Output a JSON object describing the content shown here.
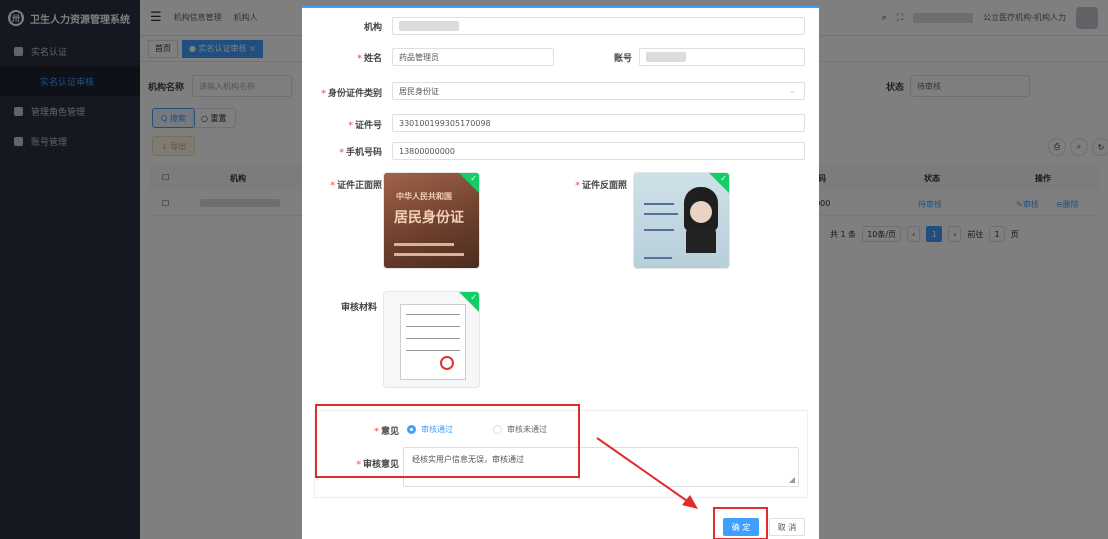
{
  "app": {
    "title": "卫生人力资源管理系统",
    "logo_mark": "(卅)",
    "sidebar": {
      "items": [
        {
          "label": "实名认证"
        },
        {
          "label": "实名认证审核"
        },
        {
          "label": "管理角色管理"
        },
        {
          "label": "账号管理"
        }
      ]
    },
    "topbar": {
      "nav1": "机构信息管理",
      "nav2": "机构人",
      "user_label": "公立医疗机构-机构人力"
    },
    "tabs": [
      {
        "label": "首页"
      },
      {
        "label": "● 实名认证审核 ×"
      }
    ],
    "filter": {
      "org_label": "机构名称",
      "org_placeholder": "请输入机构名称",
      "status_label": "状态",
      "status_value": "待审核",
      "search_btn": "Q 搜索",
      "reset_btn": "○ 重置",
      "export_btn": "↓ 导出"
    },
    "table": {
      "headers": [
        "机构",
        "号码",
        "状态",
        "操作"
      ],
      "row": {
        "code": "0000",
        "status": "待审核",
        "audit": "✎审核",
        "delete": "⊖删除"
      }
    },
    "pager": {
      "total": "共 1 条",
      "size": "10条/页",
      "current": "1",
      "goto": "前往",
      "goto_value": "1",
      "page_unit": "页"
    }
  },
  "dialog": {
    "fields": {
      "org_label": "机构",
      "name_label": "姓名",
      "name_value": "药品管理员",
      "account_label": "账号",
      "idtype_label": "身份证件类别",
      "idtype_value": "居民身份证",
      "idno_label": "证件号",
      "idno_value": "330100199305170098",
      "phone_label": "手机号码",
      "phone_value": "13800000000",
      "front_label": "证件正面照",
      "back_label": "证件反面照",
      "material_label": "审核材料"
    },
    "id_front": {
      "line1": "中华人民共和国",
      "line2": "居民身份证"
    },
    "opinion": {
      "label": "意见",
      "pass": "审核通过",
      "fail": "审核未通过",
      "comment_label": "审核意见",
      "comment_value": "经核实用户信息无误，审核通过"
    },
    "buttons": {
      "ok": "确 定",
      "cancel": "取 消"
    }
  },
  "colors": {
    "primary": "#409eff",
    "annotation_red": "#e32b2b",
    "sidebar_bg": "#2b3040"
  }
}
